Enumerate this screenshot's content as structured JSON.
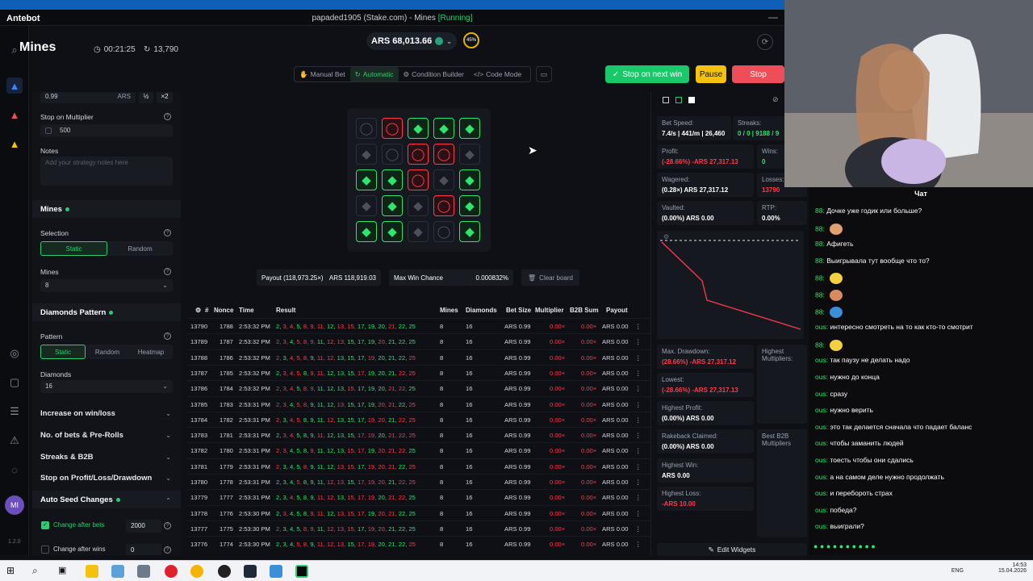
{
  "titlebar": {
    "brand": "Antebot",
    "title": "papaded1905 (Stake.com) - Mines",
    "status": "[Running]"
  },
  "header": {
    "game_title": "Mines",
    "timer": "00:21:25",
    "bets_count": "13,790",
    "balance": "ARS 68,013.66",
    "progress": "45%",
    "modes": [
      "Manual Bet",
      "Automatic",
      "Condition Builder",
      "Code Mode"
    ],
    "stop_next_win": "Stop on next win",
    "pause": "Pause",
    "stop": "Stop",
    "colors": {
      "green": "#18c96a",
      "yellow": "#f4c20d",
      "red": "#ef4d58"
    }
  },
  "left": {
    "bet_amount": "0.99",
    "bet_currency": "ARS",
    "half": "½",
    "double": "×2",
    "stop_multiplier_label": "Stop on Multiplier",
    "stop_multiplier_value": "500",
    "notes_label": "Notes",
    "notes_placeholder": "Add your strategy notes here",
    "mines_section": "Mines",
    "selection_label": "Selection",
    "selection_options": [
      "Static",
      "Random"
    ],
    "mines_label": "Mines",
    "mines_value": "8",
    "diamonds_section": "Diamonds Pattern",
    "pattern_label": "Pattern",
    "pattern_options": [
      "Static",
      "Random",
      "Heatmap"
    ],
    "diamonds_label": "Diamonds",
    "diamonds_value": "16",
    "collapsed": [
      "Increase on win/loss",
      "No. of bets & Pre-Rolls",
      "Streaks & B2B",
      "Stop on Profit/Loss/Drawdown"
    ],
    "auto_seed": "Auto Seed Changes",
    "change_after_bets": "Change after bets",
    "change_after_bets_value": "2000",
    "change_after_wins": "Change after wins",
    "change_after_wins_value": "0",
    "version": "1.2.0"
  },
  "board": {
    "tiles": [
      "mine-dim",
      "mine",
      "gem",
      "gem",
      "gem",
      "gem-dim",
      "mine-dim",
      "mine",
      "mine",
      "gem-dim",
      "gem",
      "gem",
      "mine",
      "gem-dim",
      "gem",
      "gem-dim",
      "gem",
      "gem-dim",
      "mine",
      "gem",
      "gem",
      "gem",
      "gem-dim",
      "mine-dim",
      "gem"
    ],
    "payout_label": "Payout (118,973.25×)",
    "payout_value": "ARS 118,919.03",
    "maxwin_label": "Max Win Chance",
    "maxwin_value": "0.000832%",
    "clear_board": "Clear board"
  },
  "table": {
    "headers": [
      "#",
      "Nonce",
      "Time",
      "Result",
      "Mines",
      "Diamonds",
      "Bet Size",
      "Multiplier",
      "B2B Sum",
      "Payout"
    ],
    "rows": [
      {
        "id": "13790",
        "nonce": "1788",
        "time": "2:53:32 PM",
        "mines": "8",
        "diamonds": "16",
        "bet": "ARS 0.99",
        "mult": "0.00×",
        "b2b": "0.00×",
        "payout": "ARS 0.00"
      },
      {
        "id": "13789",
        "nonce": "1787",
        "time": "2:53:32 PM",
        "mines": "8",
        "diamonds": "16",
        "bet": "ARS 0.99",
        "mult": "0.00×",
        "b2b": "0.00×",
        "payout": "ARS 0.00"
      },
      {
        "id": "13788",
        "nonce": "1786",
        "time": "2:53:32 PM",
        "mines": "8",
        "diamonds": "16",
        "bet": "ARS 0.99",
        "mult": "0.00×",
        "b2b": "0.00×",
        "payout": "ARS 0.00"
      },
      {
        "id": "13787",
        "nonce": "1785",
        "time": "2:53:32 PM",
        "mines": "8",
        "diamonds": "16",
        "bet": "ARS 0.99",
        "mult": "0.00×",
        "b2b": "0.00×",
        "payout": "ARS 0.00"
      },
      {
        "id": "13786",
        "nonce": "1784",
        "time": "2:53:32 PM",
        "mines": "8",
        "diamonds": "16",
        "bet": "ARS 0.99",
        "mult": "0.00×",
        "b2b": "0.00×",
        "payout": "ARS 0.00"
      },
      {
        "id": "13785",
        "nonce": "1783",
        "time": "2:53:31 PM",
        "mines": "8",
        "diamonds": "16",
        "bet": "ARS 0.99",
        "mult": "0.00×",
        "b2b": "0.00×",
        "payout": "ARS 0.00"
      },
      {
        "id": "13784",
        "nonce": "1782",
        "time": "2:53:31 PM",
        "mines": "8",
        "diamonds": "16",
        "bet": "ARS 0.99",
        "mult": "0.00×",
        "b2b": "0.00×",
        "payout": "ARS 0.00"
      },
      {
        "id": "13783",
        "nonce": "1781",
        "time": "2:53:31 PM",
        "mines": "8",
        "diamonds": "16",
        "bet": "ARS 0.99",
        "mult": "0.00×",
        "b2b": "0.00×",
        "payout": "ARS 0.00"
      },
      {
        "id": "13782",
        "nonce": "1780",
        "time": "2:53:31 PM",
        "mines": "8",
        "diamonds": "16",
        "bet": "ARS 0.99",
        "mult": "0.00×",
        "b2b": "0.00×",
        "payout": "ARS 0.00"
      },
      {
        "id": "13781",
        "nonce": "1779",
        "time": "2:53:31 PM",
        "mines": "8",
        "diamonds": "16",
        "bet": "ARS 0.99",
        "mult": "0.00×",
        "b2b": "0.00×",
        "payout": "ARS 0.00"
      },
      {
        "id": "13780",
        "nonce": "1778",
        "time": "2:53:31 PM",
        "mines": "8",
        "diamonds": "16",
        "bet": "ARS 0.99",
        "mult": "0.00×",
        "b2b": "0.00×",
        "payout": "ARS 0.00"
      },
      {
        "id": "13779",
        "nonce": "1777",
        "time": "2:53:31 PM",
        "mines": "8",
        "diamonds": "16",
        "bet": "ARS 0.99",
        "mult": "0.00×",
        "b2b": "0.00×",
        "payout": "ARS 0.00"
      },
      {
        "id": "13778",
        "nonce": "1776",
        "time": "2:53:30 PM",
        "mines": "8",
        "diamonds": "16",
        "bet": "ARS 0.99",
        "mult": "0.00×",
        "b2b": "0.00×",
        "payout": "ARS 0.00"
      },
      {
        "id": "13777",
        "nonce": "1775",
        "time": "2:53:30 PM",
        "mines": "8",
        "diamonds": "16",
        "bet": "ARS 0.99",
        "mult": "0.00×",
        "b2b": "0.00×",
        "payout": "ARS 0.00"
      },
      {
        "id": "13776",
        "nonce": "1774",
        "time": "2:53:30 PM",
        "mines": "8",
        "diamonds": "16",
        "bet": "ARS 0.99",
        "mult": "0.00×",
        "b2b": "0.00×",
        "payout": "ARS 0.00"
      }
    ],
    "result_numbers": [
      "2,",
      "3,",
      "4,",
      "5,",
      "8,",
      "9,",
      "11,",
      "12,",
      "13,",
      "15,",
      "17,",
      "19,",
      "20,",
      "21,",
      "22,",
      "25"
    ]
  },
  "stats": {
    "bet_speed_label": "Bet Speed:",
    "bet_speed_value": "7.4/s | 441/m | 26,460",
    "streaks_label": "Streaks:",
    "streaks_value": "0 / 0 | 9188 / 9",
    "profit_label": "Profit:",
    "profit_value": "(-28.66%) -ARS 27,317.13",
    "wins_label": "Wins:",
    "wins_value": "0",
    "wagered_label": "Wagered:",
    "wagered_value": "(0.28×) ARS 27,317.12",
    "losses_label": "Losses:",
    "losses_value": "13790",
    "vaulted_label": "Vaulted:",
    "vaulted_value": "(0.00%) ARS 0.00",
    "rtp_label": "RTP:",
    "rtp_value": "0.00%",
    "max_drawdown_label": "Max. Drawdown:",
    "max_drawdown_value": "(28.66%) -ARS 27,317.12",
    "lowest_label": "Lowest:",
    "lowest_value": "(-28.66%) -ARS 27,317.13",
    "highest_profit_label": "Highest Profit:",
    "highest_profit_value": "(0.00%) ARS 0.00",
    "rakeback_label": "Rakeback Claimed:",
    "rakeback_value": "(0.00%) ARS 0.00",
    "highest_win_label": "Highest Win:",
    "highest_win_value": "ARS 0.00",
    "highest_loss_label": "Highest Loss:",
    "highest_loss_value": "-ARS 10.00",
    "highest_mult_label": "Highest Multipliers:",
    "best_b2b_label": "Best B2B Multipliers",
    "edit_widgets": "Edit Widgets"
  },
  "chat": {
    "title": "Чат",
    "messages": [
      {
        "user": "88:",
        "text": "Дочке уже годик или больше?"
      },
      {
        "user": "88:",
        "text": ""
      },
      {
        "user": "88:",
        "text": "Афигеть"
      },
      {
        "user": "88:",
        "text": "Выигрывала тут вообще что то?"
      },
      {
        "user": "88:",
        "text": ""
      },
      {
        "user": "88:",
        "text": ""
      },
      {
        "user": "88:",
        "text": ""
      },
      {
        "user": "ous:",
        "text": "интересно смотреть на то как кто-то смотрит"
      },
      {
        "user": "88:",
        "text": ""
      },
      {
        "user": "ous:",
        "text": "так паузу не делать надо"
      },
      {
        "user": "ous:",
        "text": "нужно до конца"
      },
      {
        "user": "ous:",
        "text": "сразу"
      },
      {
        "user": "ous:",
        "text": "нужно верить"
      },
      {
        "user": "ous:",
        "text": "это так делается сначала что падает баланс"
      },
      {
        "user": "ous:",
        "text": "чтобы заманить людей"
      },
      {
        "user": "ous:",
        "text": "тоесть чтобы они сдались"
      },
      {
        "user": "ous:",
        "text": "а на самом деле нужно продолжать"
      },
      {
        "user": "ous:",
        "text": "и переборoть страх"
      },
      {
        "user": "ous:",
        "text": "победа?"
      },
      {
        "user": "ous:",
        "text": "выиграли?"
      }
    ]
  },
  "taskbar": {
    "lang": "ENG",
    "time": "14:53",
    "date": "15.04.2026"
  }
}
